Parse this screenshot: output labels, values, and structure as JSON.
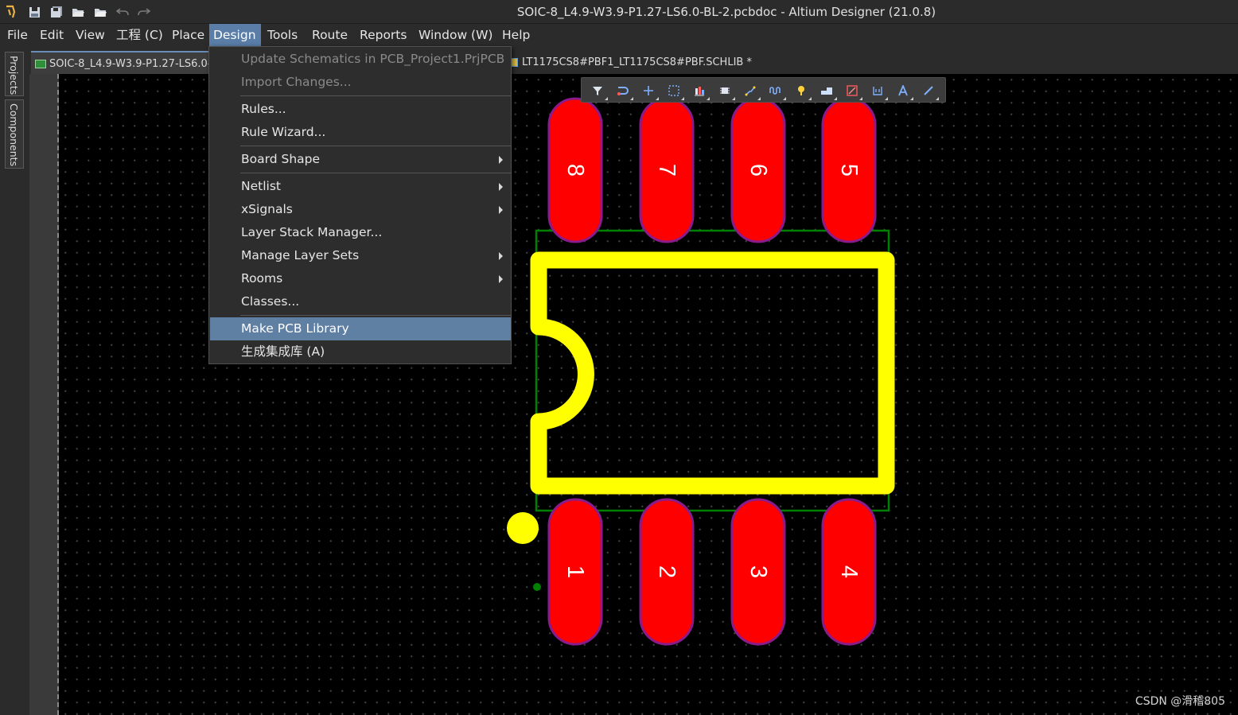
{
  "titlebar": {
    "title": "SOIC-8_L4.9-W3.9-P1.27-LS6.0-BL-2.pcbdoc - Altium Designer (21.0.8)",
    "quick_access_icons": [
      "altium-logo-icon",
      "save-icon",
      "save-all-icon",
      "open-icon",
      "open-project-icon",
      "undo-icon",
      "redo-icon"
    ]
  },
  "menubar": {
    "items": [
      "File",
      "Edit",
      "View",
      "工程 (C)",
      "Place",
      "Design",
      "Tools",
      "Route",
      "Reports",
      "Window (W)",
      "Help"
    ],
    "active": "Design"
  },
  "side_panel": {
    "tabs": [
      "Projects",
      "Components"
    ]
  },
  "tabs": [
    {
      "label": "SOIC-8_L4.9-W3.9-P1.27-LS6.0-",
      "icon": "pcb-doc-icon"
    },
    {
      "label": "LT1175CS8#PBF1_LT1175CS8#PBF.SCHLIB *",
      "icon": "schlib-doc-icon"
    }
  ],
  "design_menu": {
    "items": [
      {
        "label": "Update Schematics in PCB_Project1.PrjPCB",
        "disabled": true
      },
      {
        "label": "Import Changes...",
        "disabled": true
      },
      {
        "label": "Rules..."
      },
      {
        "label": "Rule Wizard..."
      },
      {
        "label": "Board Shape",
        "submenu": true
      },
      {
        "label": "Netlist",
        "submenu": true
      },
      {
        "label": "xSignals",
        "submenu": true
      },
      {
        "label": "Layer Stack Manager..."
      },
      {
        "label": "Manage Layer Sets",
        "submenu": true
      },
      {
        "label": "Rooms",
        "submenu": true
      },
      {
        "label": "Classes..."
      },
      {
        "label": "Make PCB Library",
        "selected": true
      },
      {
        "label": "生成集成库 (A)"
      }
    ]
  },
  "toolbar": {
    "icons": [
      "filter-icon",
      "interactive-route-icon",
      "place-cross-icon",
      "select-rect-icon",
      "align-icon",
      "component-icon",
      "route-icon",
      "length-tune-icon",
      "pad-pin-icon",
      "polygon-icon",
      "keepout-icon",
      "dimension-icon",
      "text-icon",
      "line-icon"
    ]
  },
  "pcb": {
    "top_pads": [
      "8",
      "7",
      "6",
      "5"
    ],
    "bottom_pads": [
      "1",
      "2",
      "3",
      "4"
    ],
    "colors": {
      "pad": "#ff0000",
      "pad_outline": "#8b1a8b",
      "silkscreen": "#ffff00",
      "courtyard": "#008000",
      "canvas": "#000000"
    }
  },
  "watermark": "CSDN @滑稽805"
}
